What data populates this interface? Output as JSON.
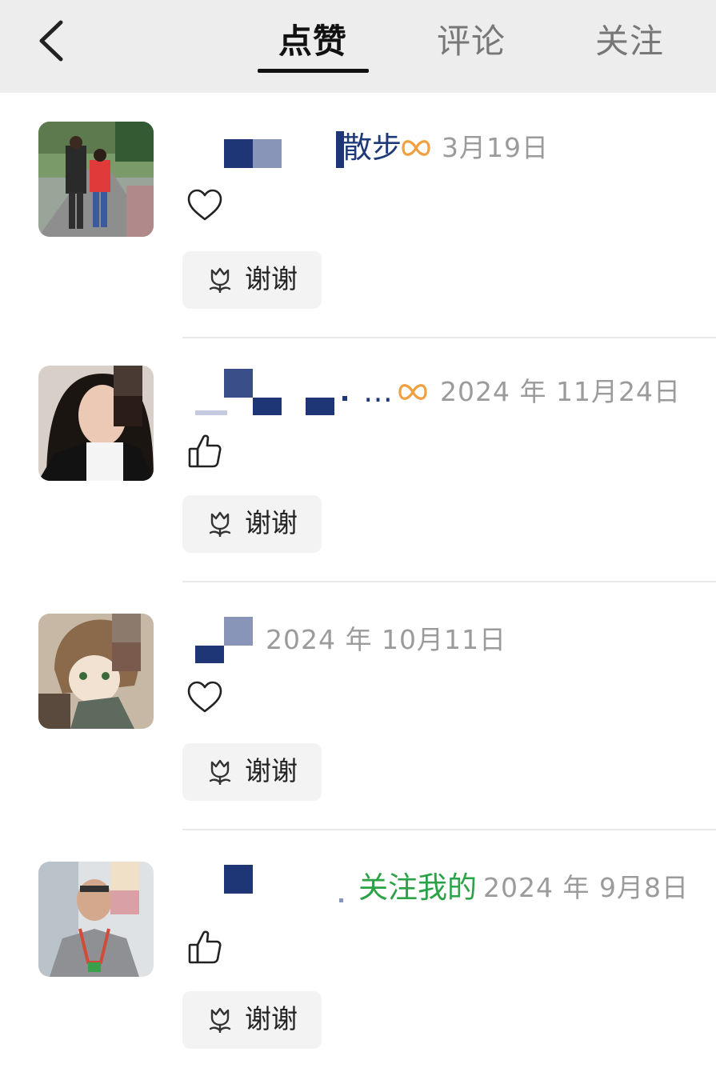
{
  "header": {
    "tabs": [
      {
        "label": "点赞",
        "active": true
      },
      {
        "label": "评论",
        "active": false
      },
      {
        "label": "关注",
        "active": false
      }
    ],
    "back_icon": "chevron-left-icon"
  },
  "items": [
    {
      "name_visible": "散步",
      "badge_icon": "infinity-loop-icon",
      "time": "3月19日",
      "like_icon": "heart-outline-icon",
      "thanks_label": "谢谢"
    },
    {
      "name_visible": "…",
      "badge_icon": "infinity-loop-icon",
      "time": "2024 年 11月24日",
      "like_icon": "thumbs-up-icon",
      "thanks_label": "谢谢"
    },
    {
      "name_visible": "",
      "time": "2024 年 10月11日",
      "like_icon": "heart-outline-icon",
      "thanks_label": "谢谢"
    },
    {
      "name_visible": "关注我的",
      "time": "2024 年 9月8日",
      "like_icon": "thumbs-up-icon",
      "thanks_label": "谢谢"
    }
  ],
  "colors": {
    "header_bg": "#ededed",
    "name_blue": "#1f3a78",
    "name_green": "#2ba245",
    "badge_orange": "#f0a040",
    "time_gray": "#9b9b9b"
  }
}
